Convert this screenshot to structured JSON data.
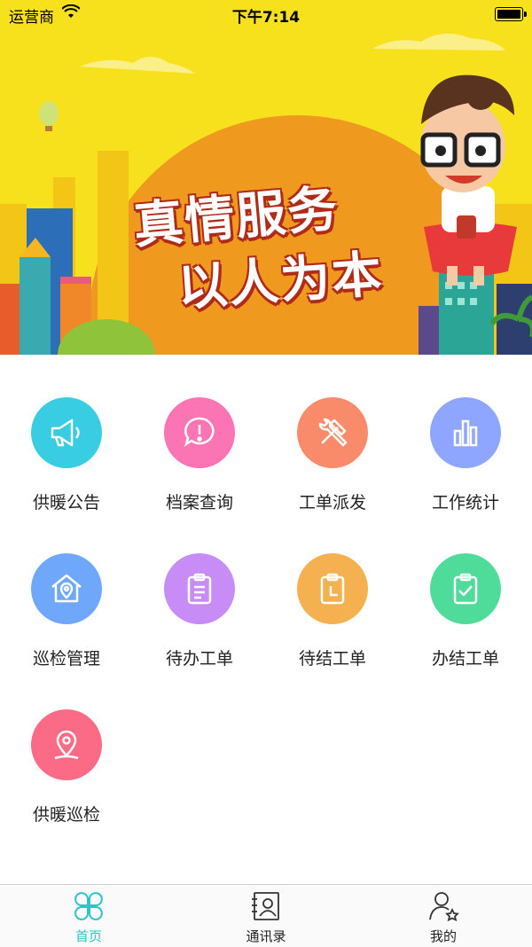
{
  "status_bar": {
    "carrier": "运营商",
    "time": "下午7:14"
  },
  "banner": {
    "line1": "真情服务",
    "line2": "以人为本"
  },
  "menu": [
    {
      "label": "供暖公告",
      "color": "#38cde3",
      "icon": "megaphone-icon"
    },
    {
      "label": "档案查询",
      "color": "#fb74b4",
      "icon": "alert-bubble-icon"
    },
    {
      "label": "工单派发",
      "color": "#f98b6b",
      "icon": "tools-icon"
    },
    {
      "label": "工作统计",
      "color": "#8ea6ff",
      "icon": "bar-chart-icon"
    },
    {
      "label": "巡检管理",
      "color": "#6fa8fb",
      "icon": "home-location-icon"
    },
    {
      "label": "待办工单",
      "color": "#c78cf5",
      "icon": "clipboard-list-icon"
    },
    {
      "label": "待结工单",
      "color": "#f5b150",
      "icon": "clipboard-clock-icon"
    },
    {
      "label": "办结工单",
      "color": "#4fdc9a",
      "icon": "clipboard-check-icon"
    },
    {
      "label": "供暖巡检",
      "color": "#fb6b86",
      "icon": "map-pin-icon"
    }
  ],
  "tabbar": {
    "accent": "#2ec4c8",
    "items": [
      {
        "label": "首页",
        "icon": "clover-home-icon",
        "active": true
      },
      {
        "label": "通讯录",
        "icon": "contacts-book-icon",
        "active": false
      },
      {
        "label": "我的",
        "icon": "user-star-icon",
        "active": false
      }
    ]
  }
}
